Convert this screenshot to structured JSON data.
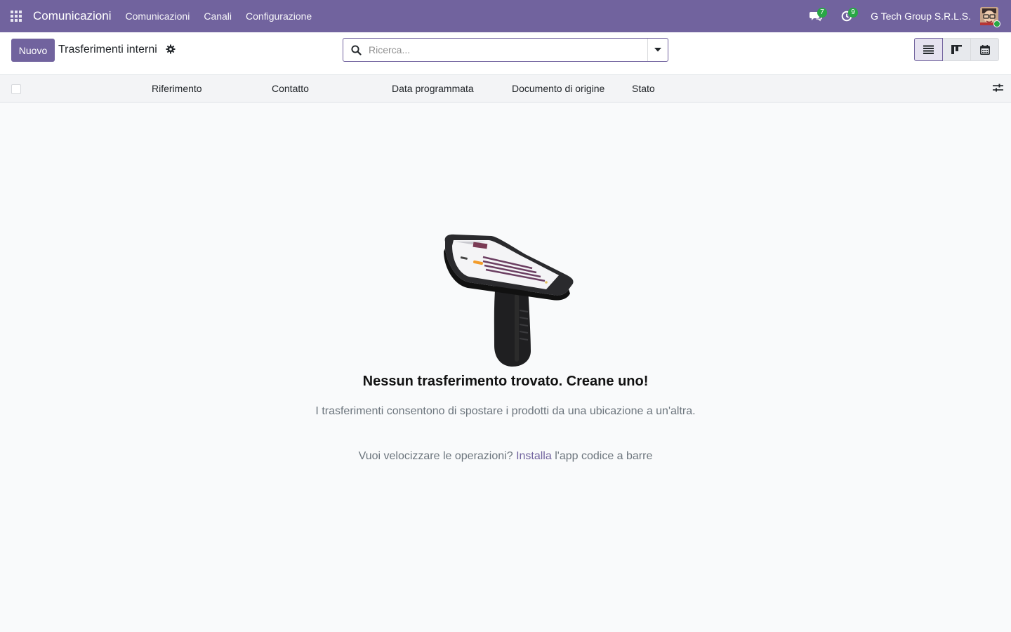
{
  "navbar": {
    "app_name": "Comunicazioni",
    "menu": [
      "Comunicazioni",
      "Canali",
      "Configurazione"
    ],
    "messages_count": "7",
    "activities_count": "9",
    "company": "G Tech Group S.R.L.S.",
    "accent_color": "#71639e"
  },
  "control_panel": {
    "new_label": "Nuovo",
    "title": "Trasferimenti interni",
    "search_placeholder": "Ricerca...",
    "views": [
      "list-icon",
      "kanban-icon",
      "calendar-icon"
    ],
    "active_view": "list-icon"
  },
  "list": {
    "columns": [
      "Riferimento",
      "Contatto",
      "Data programmata",
      "Documento di origine",
      "Stato"
    ]
  },
  "empty_state": {
    "title": "Nessun trasferimento trovato. Creane uno!",
    "description": "I trasferimenti consentono di spostare i prodotti da una ubicazione a un'altra.",
    "hint_prefix": "Vuoi velocizzare le operazioni?",
    "hint_link": "Installa",
    "hint_suffix": "l'app codice a barre"
  }
}
